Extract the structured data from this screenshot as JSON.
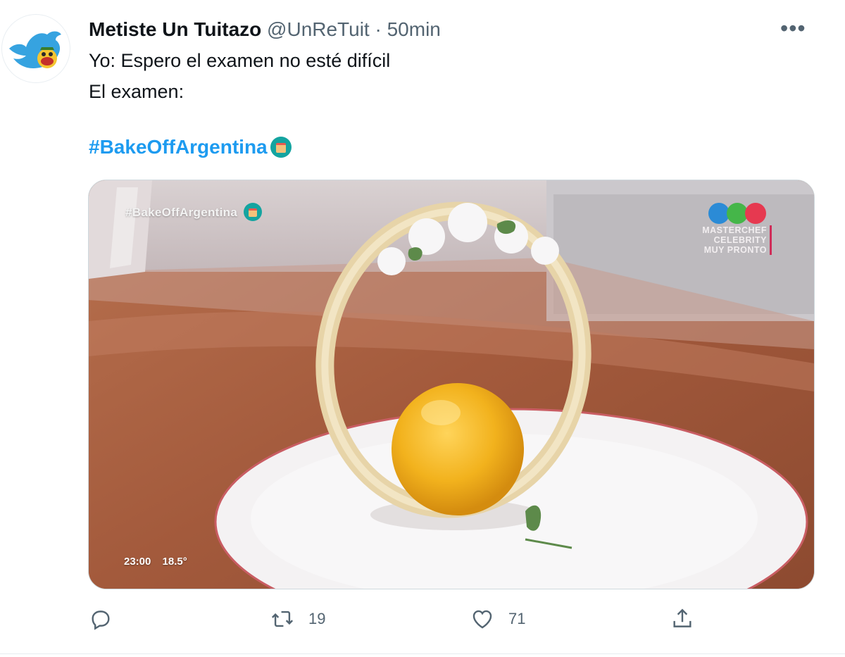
{
  "tweet": {
    "display_name": "Metiste Un Tuitazo",
    "handle": "@UnReTuit",
    "separator": "·",
    "time": "50min",
    "line1": "Yo: Espero el examen no esté difícil",
    "line2": "El examen:",
    "hashtag": "#BakeOffArgentina",
    "more_label": "•••"
  },
  "media": {
    "overlay_hashtag": "#BakeOffArgentina",
    "masterchef_lines": [
      "MASTERCHEF",
      "CELEBRITY",
      "MUY PRONTO"
    ],
    "clock": "23:00",
    "temperature": "18.5°"
  },
  "actions": {
    "reply_count": "",
    "retweet_count": "19",
    "like_count": "71"
  },
  "colors": {
    "accent": "#1d9bf0",
    "secondary_text": "#536471"
  }
}
